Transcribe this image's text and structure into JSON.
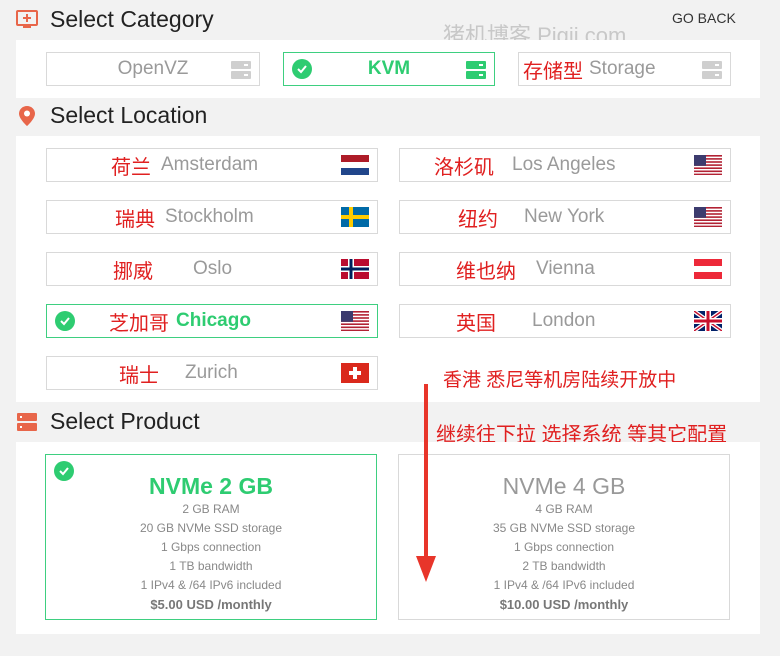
{
  "category": {
    "title": "Select Category",
    "go_back": "GO BACK",
    "watermark": "猪机博客 Pigji.com",
    "options": [
      {
        "label": "OpenVZ",
        "selected": false
      },
      {
        "label": "KVM",
        "selected": true
      },
      {
        "cn": "存储型",
        "label": "Storage",
        "selected": false
      }
    ]
  },
  "location": {
    "title": "Select Location",
    "items": [
      {
        "cn": "荷兰",
        "en": "Amsterdam",
        "flag": "netherlands-flag"
      },
      {
        "cn": "洛杉矶",
        "en": "Los Angeles",
        "flag": "usa-flag"
      },
      {
        "cn": "瑞典",
        "en": "Stockholm",
        "flag": "sweden-flag"
      },
      {
        "cn": "纽约",
        "en": "New York",
        "flag": "usa-flag"
      },
      {
        "cn": "挪威",
        "en": "Oslo",
        "flag": "norway-flag"
      },
      {
        "cn": "维也纳",
        "en": "Vienna",
        "flag": "austria-flag"
      },
      {
        "cn": "芝加哥",
        "en": "Chicago",
        "flag": "usa-flag",
        "selected": true
      },
      {
        "cn": "英国",
        "en": "London",
        "flag": "uk-flag"
      },
      {
        "cn": "瑞士",
        "en": "Zurich",
        "flag": "switzerland-flag"
      }
    ],
    "note": "香港 悉尼等机房陆续开放中"
  },
  "product": {
    "title": "Select Product",
    "note": "继续往下拉 选择系统 等其它配置",
    "plans": [
      {
        "name": "NVMe 2 GB",
        "ram": "2 GB RAM",
        "storage": "20 GB NVMe SSD storage",
        "conn": "1 Gbps connection",
        "bw": "1 TB bandwidth",
        "ip": "1 IPv4 & /64 IPv6 included",
        "price": "$5.00 USD /monthly",
        "selected": true
      },
      {
        "name": "NVMe 4 GB",
        "ram": "4 GB RAM",
        "storage": "35 GB NVMe SSD storage",
        "conn": "1 Gbps connection",
        "bw": "2 TB bandwidth",
        "ip": "1 IPv4 & /64 IPv6 included",
        "price": "$10.00 USD /monthly",
        "selected": false
      }
    ]
  },
  "colors": {
    "accent": "#2ecc71",
    "annotation": "#e02020",
    "icon": "#e8664a"
  }
}
